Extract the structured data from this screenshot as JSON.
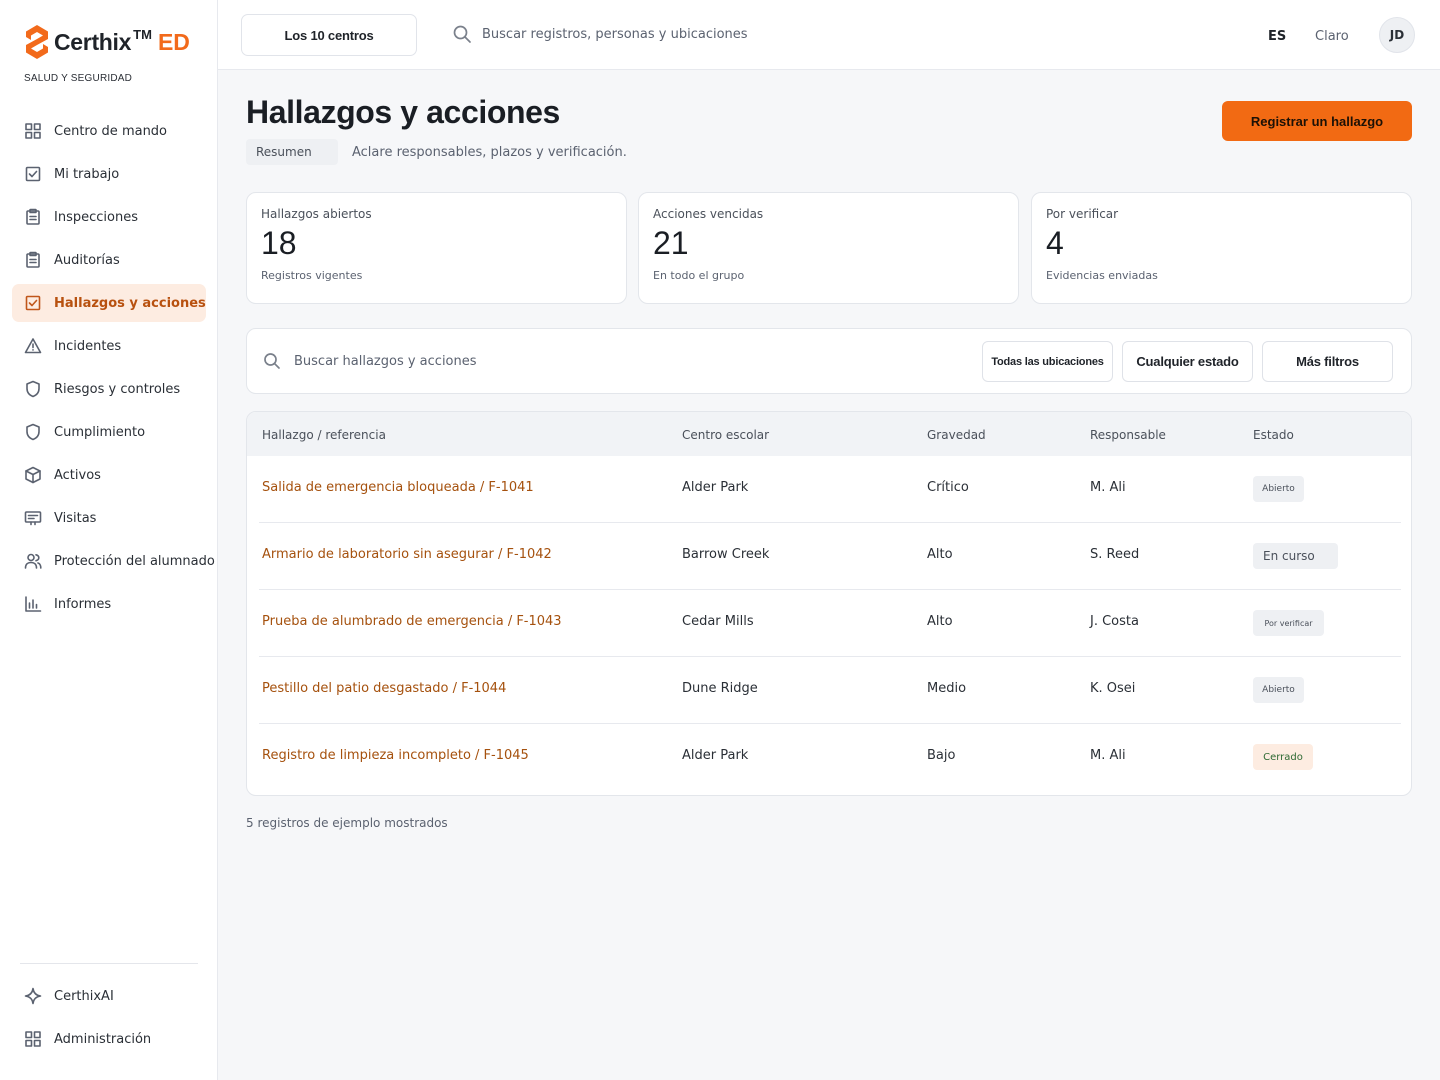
{
  "brand": {
    "name": "Certhix",
    "tm": "TM",
    "suffix": "ED",
    "subtitle": "SALUD Y SEGURIDAD",
    "accent": "#f26a1b"
  },
  "sidebar": {
    "items": [
      {
        "label": "Centro de mando",
        "icon": "grid-icon",
        "active": false
      },
      {
        "label": "Mi trabajo",
        "icon": "check-square-icon",
        "active": false
      },
      {
        "label": "Inspecciones",
        "icon": "clipboard-icon",
        "active": false
      },
      {
        "label": "Auditorías",
        "icon": "clipboard-icon",
        "active": false
      },
      {
        "label": "Hallazgos y acciones",
        "icon": "check-square-icon",
        "active": true
      },
      {
        "label": "Incidentes",
        "icon": "warning-icon",
        "active": false
      },
      {
        "label": "Riesgos y controles",
        "icon": "shield-icon",
        "active": false
      },
      {
        "label": "Cumplimiento",
        "icon": "shield-icon",
        "active": false
      },
      {
        "label": "Activos",
        "icon": "box-icon",
        "active": false
      },
      {
        "label": "Visitas",
        "icon": "id-card-icon",
        "active": false
      },
      {
        "label": "Protección del alumnado",
        "icon": "users-icon",
        "active": false
      },
      {
        "label": "Informes",
        "icon": "bar-chart-icon",
        "active": false
      }
    ],
    "bottom": [
      {
        "label": "CerthixAI",
        "icon": "sparkle-icon"
      },
      {
        "label": "Administración",
        "icon": "grid-icon"
      }
    ]
  },
  "header": {
    "centers_label": "Los 10 centros",
    "search_placeholder": "Buscar registros, personas y ubicaciones",
    "language": "ES",
    "theme": "Claro",
    "avatar_initials": "JD"
  },
  "page": {
    "title": "Hallazgos y acciones",
    "tag": "Resumen",
    "subtitle": "Aclare responsables, plazos y verificación.",
    "primary_action": "Registrar un hallazgo"
  },
  "stats": [
    {
      "label": "Hallazgos abiertos",
      "value": "18",
      "note": "Registros vigentes"
    },
    {
      "label": "Acciones vencidas",
      "value": "21",
      "note": "En todo el grupo"
    },
    {
      "label": "Por verificar",
      "value": "4",
      "note": "Evidencias enviadas"
    }
  ],
  "filters": {
    "search_placeholder": "Buscar hallazgos y acciones",
    "locations": "Todas las ubicaciones",
    "status": "Cualquier estado",
    "more": "Más filtros"
  },
  "table": {
    "columns": [
      "Hallazgo / referencia",
      "Centro escolar",
      "Gravedad",
      "Responsable",
      "Estado"
    ],
    "rows": [
      {
        "finding": "Salida de emergencia bloqueada / F-1041",
        "center": "Alder Park",
        "severity": "Crítico",
        "owner": "M. Ali",
        "status": "Abierto"
      },
      {
        "finding": "Armario de laboratorio sin asegurar / F-1042",
        "center": "Barrow Creek",
        "severity": "Alto",
        "owner": "S. Reed",
        "status": "En curso"
      },
      {
        "finding": "Prueba de alumbrado de emergencia / F-1043",
        "center": "Cedar Mills",
        "severity": "Alto",
        "owner": "J. Costa",
        "status": "Por verificar"
      },
      {
        "finding": "Pestillo del patio desgastado / F-1044",
        "center": "Dune Ridge",
        "severity": "Medio",
        "owner": "K. Osei",
        "status": "Abierto"
      },
      {
        "finding": "Registro de limpieza incompleto / F-1045",
        "center": "Alder Park",
        "severity": "Bajo",
        "owner": "M. Ali",
        "status": "Cerrado"
      }
    ]
  },
  "footnote": "5 registros de ejemplo mostrados"
}
